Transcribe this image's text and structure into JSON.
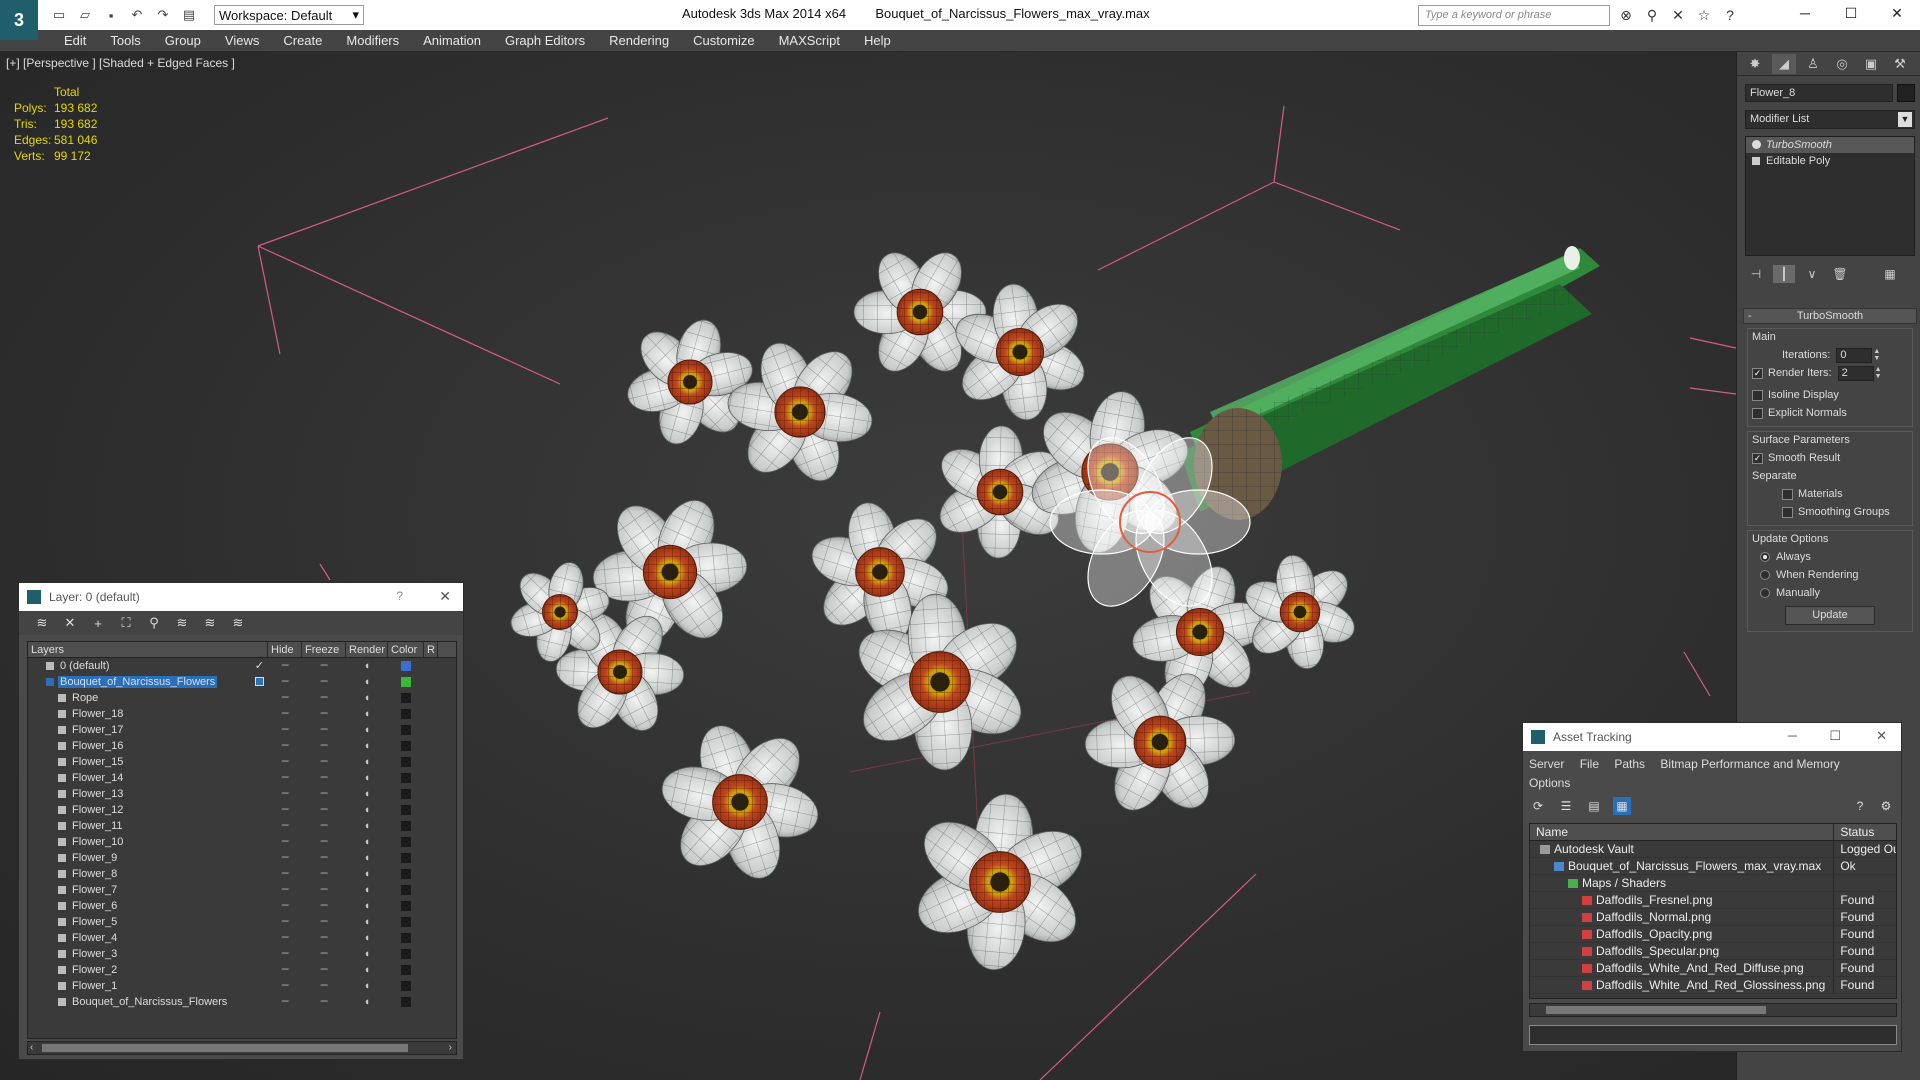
{
  "titlebar": {
    "workspace": "Workspace: Default",
    "app_title": "Autodesk 3ds Max  2014 x64",
    "file_title": "Bouquet_of_Narcissus_Flowers_max_vray.max",
    "search_placeholder": "Type a keyword or phrase"
  },
  "menu": [
    "Edit",
    "Tools",
    "Group",
    "Views",
    "Create",
    "Modifiers",
    "Animation",
    "Graph Editors",
    "Rendering",
    "Customize",
    "MAXScript",
    "Help"
  ],
  "viewport": {
    "label": "[+] [Perspective ] [Shaded + Edged Faces ]",
    "stats": {
      "header": "Total",
      "rows": [
        {
          "k": "Polys:",
          "v": "193 682"
        },
        {
          "k": "Tris:",
          "v": "193 682"
        },
        {
          "k": "Edges:",
          "v": "581 046"
        },
        {
          "k": "Verts:",
          "v": "99 172"
        }
      ]
    }
  },
  "command_panel": {
    "object_name": "Flower_8",
    "modifier_list": "Modifier List",
    "stack": [
      {
        "label": "TurboSmooth",
        "selected": true
      },
      {
        "label": "Editable Poly",
        "selected": false
      }
    ],
    "rollout_title": "TurboSmooth",
    "main_group": "Main",
    "iterations_label": "Iterations:",
    "iterations_value": "0",
    "render_iters_label": "Render Iters:",
    "render_iters_value": "2",
    "isoline_label": "Isoline Display",
    "explicit_normals_label": "Explicit Normals",
    "surface_group": "Surface Parameters",
    "smooth_result_label": "Smooth Result",
    "separate_label": "Separate",
    "materials_label": "Materials",
    "smoothing_groups_label": "Smoothing Groups",
    "update_group": "Update Options",
    "always_label": "Always",
    "when_rendering_label": "When Rendering",
    "manually_label": "Manually",
    "update_button": "Update"
  },
  "layer_explorer": {
    "title": "Layer: 0 (default)",
    "help": "?",
    "columns": [
      "Layers",
      "Hide",
      "Freeze",
      "Render",
      "Color",
      "R"
    ],
    "rows": [
      {
        "name": "0 (default)",
        "level": 1,
        "color": "#3a6fd0",
        "check": true
      },
      {
        "name": "Bouquet_of_Narcissus_Flowers",
        "level": 1,
        "color": "#3ab83a",
        "selected": true
      },
      {
        "name": "Rope",
        "level": 2,
        "color": "#1a1a1a"
      },
      {
        "name": "Flower_18",
        "level": 2,
        "color": "#1a1a1a"
      },
      {
        "name": "Flower_17",
        "level": 2,
        "color": "#1a1a1a"
      },
      {
        "name": "Flower_16",
        "level": 2,
        "color": "#1a1a1a"
      },
      {
        "name": "Flower_15",
        "level": 2,
        "color": "#1a1a1a"
      },
      {
        "name": "Flower_14",
        "level": 2,
        "color": "#1a1a1a"
      },
      {
        "name": "Flower_13",
        "level": 2,
        "color": "#1a1a1a"
      },
      {
        "name": "Flower_12",
        "level": 2,
        "color": "#1a1a1a"
      },
      {
        "name": "Flower_11",
        "level": 2,
        "color": "#1a1a1a"
      },
      {
        "name": "Flower_10",
        "level": 2,
        "color": "#1a1a1a"
      },
      {
        "name": "Flower_9",
        "level": 2,
        "color": "#1a1a1a"
      },
      {
        "name": "Flower_8",
        "level": 2,
        "color": "#1a1a1a"
      },
      {
        "name": "Flower_7",
        "level": 2,
        "color": "#1a1a1a"
      },
      {
        "name": "Flower_6",
        "level": 2,
        "color": "#1a1a1a"
      },
      {
        "name": "Flower_5",
        "level": 2,
        "color": "#1a1a1a"
      },
      {
        "name": "Flower_4",
        "level": 2,
        "color": "#1a1a1a"
      },
      {
        "name": "Flower_3",
        "level": 2,
        "color": "#1a1a1a"
      },
      {
        "name": "Flower_2",
        "level": 2,
        "color": "#1a1a1a"
      },
      {
        "name": "Flower_1",
        "level": 2,
        "color": "#1a1a1a"
      },
      {
        "name": "Bouquet_of_Narcissus_Flowers",
        "level": 2,
        "color": "#1a1a1a"
      }
    ]
  },
  "asset_tracking": {
    "title": "Asset Tracking",
    "menu_line1": [
      "Server",
      "File",
      "Paths",
      "Bitmap Performance and Memory"
    ],
    "menu_line2": [
      "Options"
    ],
    "columns": [
      "Name",
      "Status"
    ],
    "rows": [
      {
        "name": "Autodesk Vault",
        "status": "Logged Ou",
        "level": 1,
        "icon": "vault"
      },
      {
        "name": "Bouquet_of_Narcissus_Flowers_max_vray.max",
        "status": "Ok",
        "level": 2,
        "icon": "max"
      },
      {
        "name": "Maps / Shaders",
        "status": "",
        "level": 3,
        "icon": "folder"
      },
      {
        "name": "Daffodils_Fresnel.png",
        "status": "Found",
        "level": 4,
        "icon": "png"
      },
      {
        "name": "Daffodils_Normal.png",
        "status": "Found",
        "level": 4,
        "icon": "png"
      },
      {
        "name": "Daffodils_Opacity.png",
        "status": "Found",
        "level": 4,
        "icon": "png"
      },
      {
        "name": "Daffodils_Specular.png",
        "status": "Found",
        "level": 4,
        "icon": "png"
      },
      {
        "name": "Daffodils_White_And_Red_Diffuse.png",
        "status": "Found",
        "level": 4,
        "icon": "png"
      },
      {
        "name": "Daffodils_White_And_Red_Glossiness.png",
        "status": "Found",
        "level": 4,
        "icon": "png"
      }
    ]
  },
  "colors": {
    "stats_yellow": "#e6d700",
    "selection_blue": "#2a6fb8",
    "grid_pink": "#d65a8a",
    "petal_white": "#e8ecea",
    "corona_orange": "#c2461e",
    "stem_green": "#2e8a3a"
  }
}
